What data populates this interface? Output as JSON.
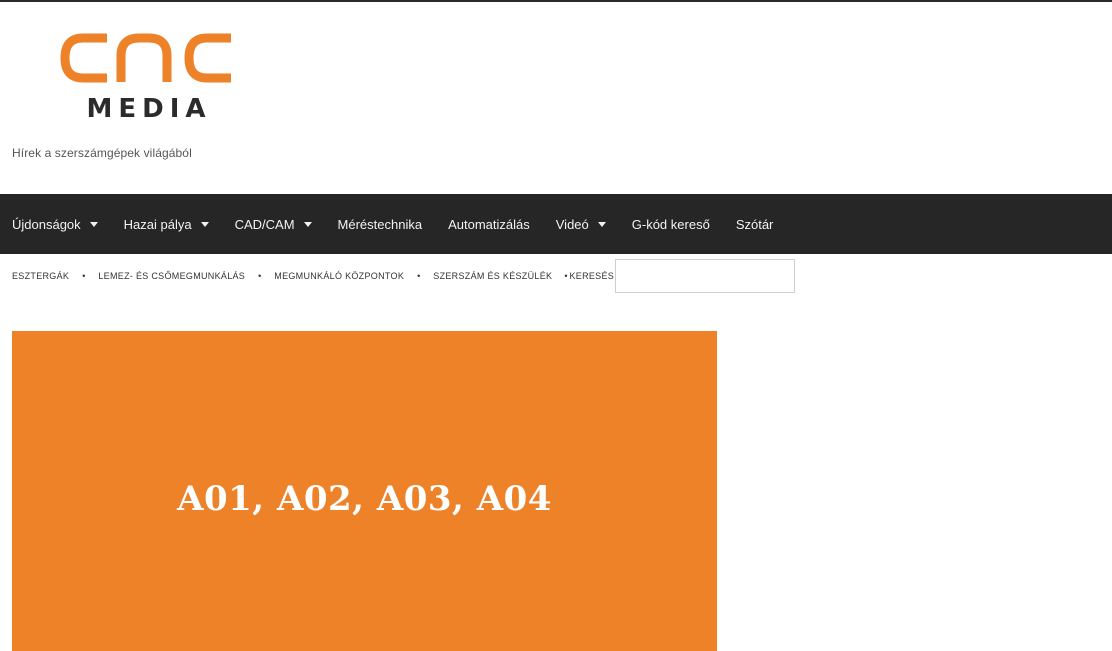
{
  "brand": {
    "logo_mark": "CNC",
    "logo_word": "MEDIA",
    "tagline": "Hírek a szerszámgépek világából",
    "accent_color": "#ee8229",
    "dark_color": "#262626"
  },
  "main_nav": {
    "items": [
      {
        "label": "Újdonságok",
        "has_dropdown": true,
        "icon": "chevron-down-icon"
      },
      {
        "label": "Hazai pálya",
        "has_dropdown": true,
        "icon": "chevron-down-icon"
      },
      {
        "label": "CAD/CAM",
        "has_dropdown": true,
        "icon": "chevron-down-icon"
      },
      {
        "label": "Méréstechnika",
        "has_dropdown": false
      },
      {
        "label": "Automatizálás",
        "has_dropdown": false
      },
      {
        "label": "Videó",
        "has_dropdown": true,
        "icon": "chevron-down-icon"
      },
      {
        "label": "G-kód kereső",
        "has_dropdown": false
      },
      {
        "label": "Szótár",
        "has_dropdown": false
      }
    ]
  },
  "sub_nav": {
    "items": [
      {
        "label": "ESZTERGÁK"
      },
      {
        "label": "LEMEZ- ÉS CSŐMEGMUNKÁLÁS"
      },
      {
        "label": "MEGMUNKÁLÓ KÖZPONTOK"
      },
      {
        "label": "SZERSZÁM ÉS KÉSZÜLÉK"
      },
      {
        "label": "KERESÉS"
      }
    ],
    "separator": "•",
    "search": {
      "value": "",
      "placeholder": ""
    }
  },
  "banner": {
    "text": "A01, A02, A03, A04",
    "background": "#ee8229"
  }
}
